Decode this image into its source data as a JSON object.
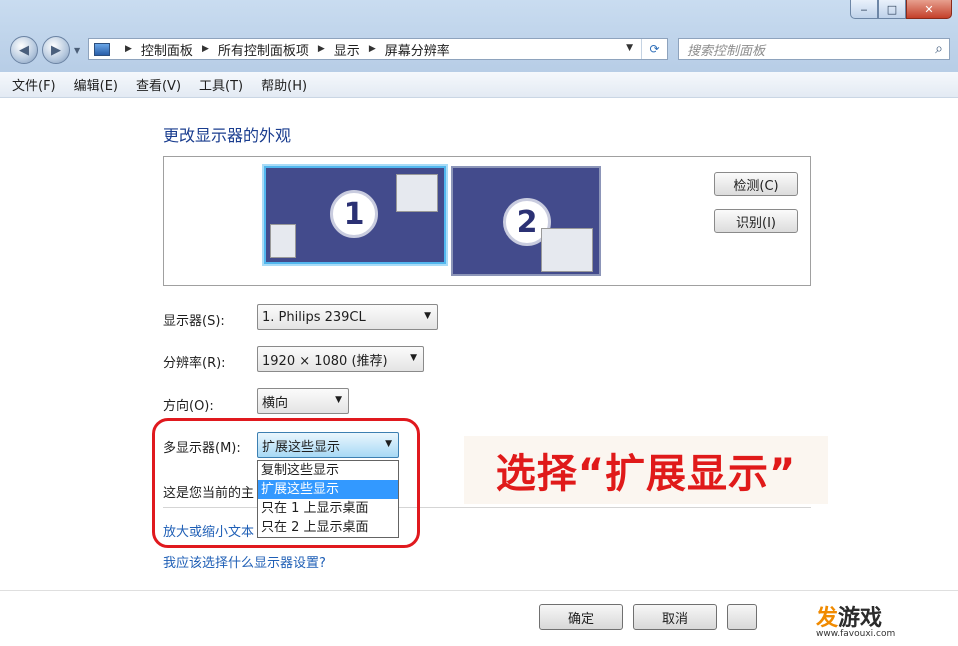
{
  "window": {
    "min_glyph": "‒",
    "max_glyph": "□",
    "close_glyph": "✕"
  },
  "address": {
    "crumbs": [
      "控制面板",
      "所有控制面板项",
      "显示",
      "屏幕分辨率"
    ]
  },
  "search": {
    "placeholder": "搜索控制面板"
  },
  "menu": [
    "文件(F)",
    "编辑(E)",
    "查看(V)",
    "工具(T)",
    "帮助(H)"
  ],
  "heading": "更改显示器的外观",
  "monitors": [
    "1",
    "2"
  ],
  "side_buttons": {
    "detect": "检测(C)",
    "identify": "识别(I)"
  },
  "settings": {
    "display_label": "显示器(S):",
    "display_value": "1. Philips 239CL",
    "resolution_label": "分辨率(R):",
    "resolution_value": "1920 × 1080 (推荐)",
    "orientation_label": "方向(O):",
    "orientation_value": "横向",
    "multi_label": "多显示器(M):",
    "multi_value": "扩展这些显示"
  },
  "multi_options": [
    "复制这些显示",
    "扩展这些显示",
    "只在 1 上显示桌面",
    "只在 2 上显示桌面"
  ],
  "multi_selected_index": 1,
  "status_text": "这是您当前的主",
  "links": {
    "enlarge": "放大或缩小文本",
    "help": "我应该选择什么显示器设置?"
  },
  "annotation": "选择“扩展显示”",
  "buttons": {
    "ok": "确定",
    "cancel": "取消"
  },
  "watermark": {
    "brand_part1": "发",
    "brand_part2": "游戏",
    "url": "www.favouxi.com"
  },
  "colors": {
    "annotation_red": "#e01a1a",
    "selection_blue": "#3399ff",
    "link_blue": "#1f5fb6"
  }
}
